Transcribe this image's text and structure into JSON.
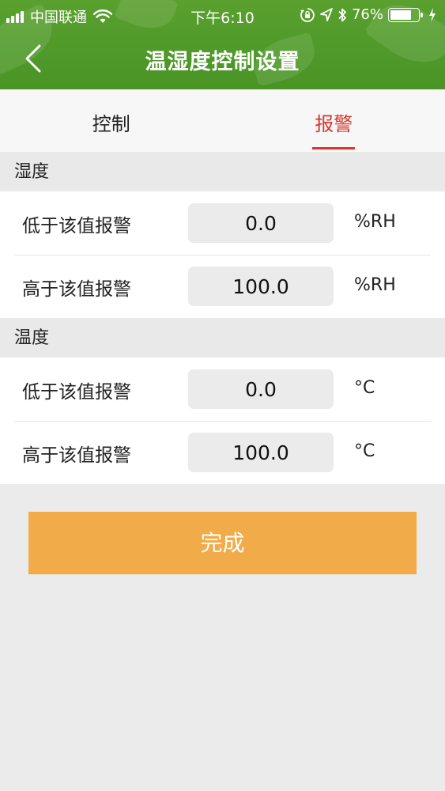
{
  "status_bar": {
    "carrier": "中国联通",
    "time": "下午6:10",
    "battery_percent": "76%",
    "battery_level": 0.76,
    "icons": [
      "signal-icon",
      "wifi-icon",
      "orientation-lock-icon",
      "location-icon",
      "bluetooth-icon",
      "battery-icon",
      "charging-icon"
    ]
  },
  "navbar": {
    "title": "温湿度控制设置",
    "back_icon": "chevron-left-icon"
  },
  "tabs": [
    {
      "label": "控制",
      "active": false
    },
    {
      "label": "报警",
      "active": true
    }
  ],
  "humidity": {
    "title": "湿度",
    "rows": [
      {
        "label": "低于该值报警",
        "value": "0.0",
        "unit": "%RH"
      },
      {
        "label": "高于该值报警",
        "value": "100.0",
        "unit": "%RH"
      }
    ]
  },
  "temperature": {
    "title": "温度",
    "rows": [
      {
        "label": "低于该值报警",
        "value": "0.0",
        "unit": "°C"
      },
      {
        "label": "高于该值报警",
        "value": "100.0",
        "unit": "°C"
      }
    ]
  },
  "done_button": "完成",
  "colors": {
    "header_green": "#4f9a2a",
    "accent_red": "#d9362c",
    "button_orange": "#f1ab48",
    "page_background": "#ebebeb"
  }
}
